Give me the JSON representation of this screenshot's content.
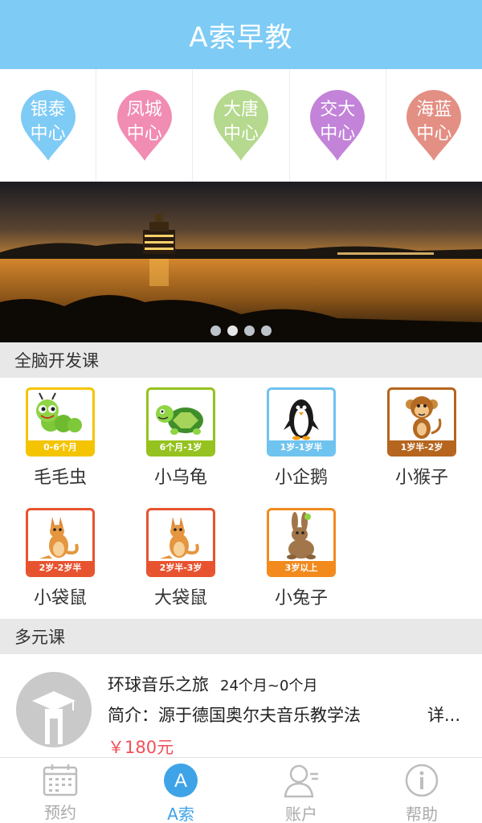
{
  "header": {
    "title": "A索早教"
  },
  "centers": [
    {
      "line1": "银泰",
      "line2": "中心",
      "color": "#7ecbf5"
    },
    {
      "line1": "凤城",
      "line2": "中心",
      "color": "#f18cb3"
    },
    {
      "line1": "大唐",
      "line2": "中心",
      "color": "#b5d98e"
    },
    {
      "line1": "交大",
      "line2": "中心",
      "color": "#c283d9"
    },
    {
      "line1": "海蓝",
      "line2": "中心",
      "color": "#e38f84"
    }
  ],
  "banner": {
    "dot_count": 4,
    "active_dot": 1
  },
  "section_brain": {
    "title": "全脑开发课"
  },
  "courses": [
    {
      "name": "毛毛虫",
      "age": "0-6个月",
      "color": "#f5c400",
      "animal": "caterpillar"
    },
    {
      "name": "小乌龟",
      "age": "6个月-1岁",
      "color": "#95c21f",
      "animal": "turtle"
    },
    {
      "name": "小企鹅",
      "age": "1岁-1岁半",
      "color": "#6fc3ef",
      "animal": "penguin"
    },
    {
      "name": "小猴子",
      "age": "1岁半-2岁",
      "color": "#b5651d",
      "animal": "monkey"
    },
    {
      "name": "小袋鼠",
      "age": "2岁-2岁半",
      "color": "#e8532f",
      "animal": "kangaroo"
    },
    {
      "name": "大袋鼠",
      "age": "2岁半-3岁",
      "color": "#e8532f",
      "animal": "kangaroo"
    },
    {
      "name": "小兔子",
      "age": "3岁以上",
      "color": "#f28a1e",
      "animal": "rabbit"
    }
  ],
  "section_multi": {
    "title": "多元课"
  },
  "multi_course": {
    "title": "环球音乐之旅",
    "age_range": "24个月~0个月",
    "intro": "简介：源于德国奥尔夫音乐教学法",
    "detail": "详...",
    "price": "￥180元"
  },
  "tabs": [
    {
      "label": "预约",
      "icon": "calendar-icon",
      "active": false
    },
    {
      "label": "A索",
      "icon": "a-logo-icon",
      "active": true
    },
    {
      "label": "账户",
      "icon": "account-icon",
      "active": false
    },
    {
      "label": "帮助",
      "icon": "info-icon",
      "active": false
    }
  ]
}
